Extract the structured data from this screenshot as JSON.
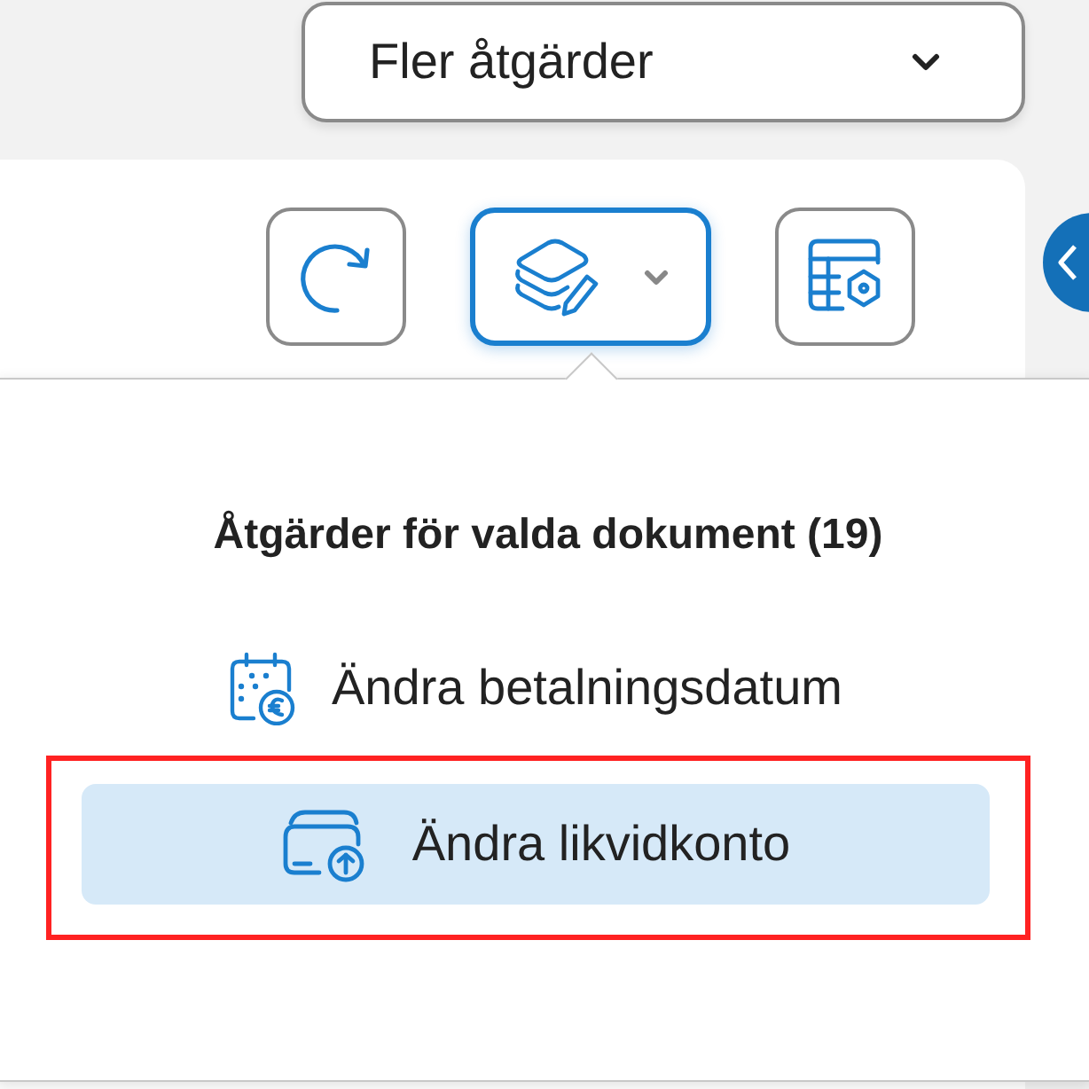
{
  "more_actions": {
    "label": "Fler åtgärder"
  },
  "toolbar": [
    {
      "kind": "refresh",
      "selected": false,
      "has_menu": false
    },
    {
      "kind": "bulk_edit",
      "selected": true,
      "has_menu": true
    },
    {
      "kind": "table_settings",
      "selected": false,
      "has_menu": false
    }
  ],
  "popup": {
    "title": "Åtgärder för valda dokument (19)",
    "items": [
      {
        "kind": "calendar_euro",
        "label": "Ändra betalningsdatum",
        "selected": false,
        "annotated": false
      },
      {
        "kind": "card_upload",
        "label": "Ändra likvidkonto",
        "selected": true,
        "annotated": true
      }
    ]
  }
}
